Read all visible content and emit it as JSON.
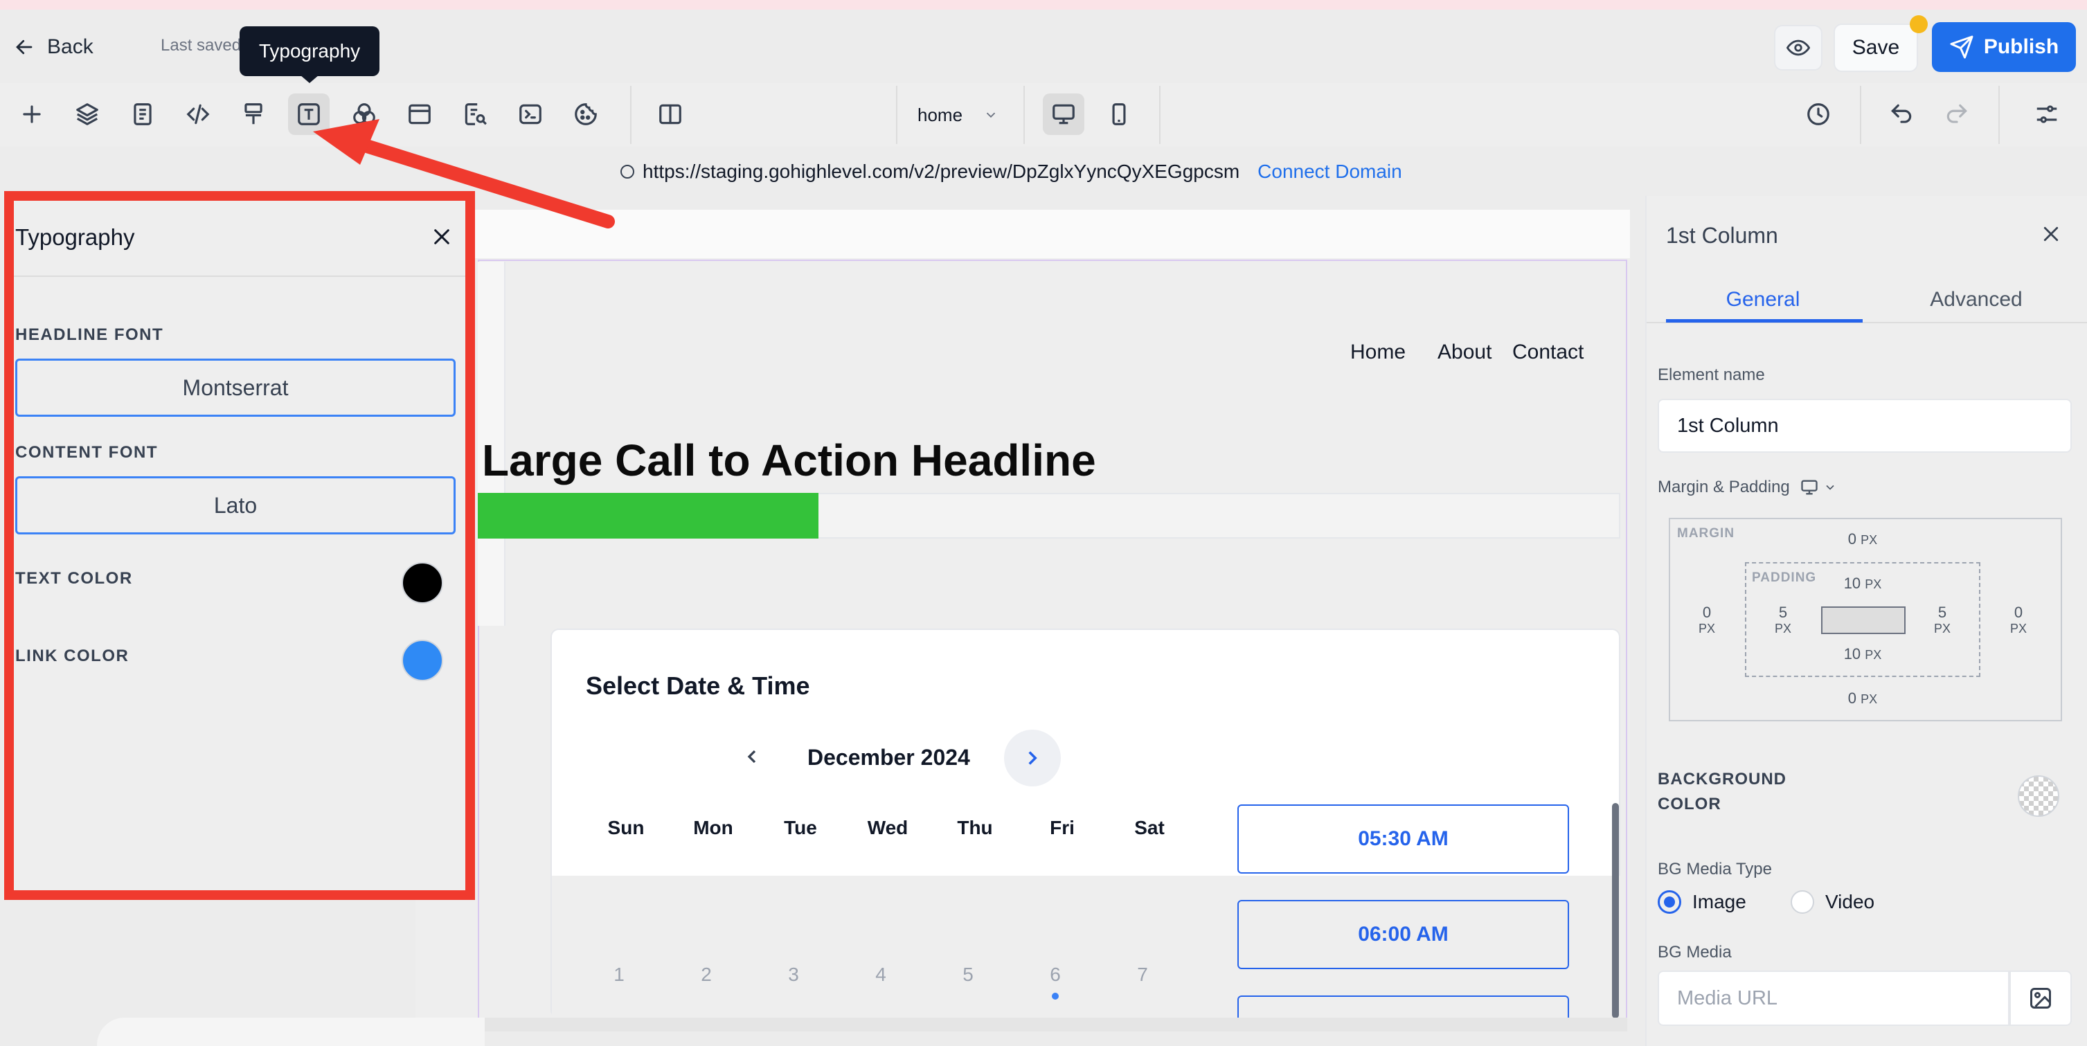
{
  "topbar": {
    "back_label": "Back",
    "last_saved": "Last saved",
    "tooltip": "Typography",
    "save_label": "Save",
    "publish_label": "Publish"
  },
  "toolbar": {
    "page_select": "home",
    "url": "https://staging.gohighlevel.com/v2/preview/DpZglxYyncQyXEGgpcsm",
    "connect_domain": "Connect Domain"
  },
  "typography_panel": {
    "title": "Typography",
    "headline_font_label": "HEADLINE FONT",
    "headline_font_value": "Montserrat",
    "content_font_label": "CONTENT FONT",
    "content_font_value": "Lato",
    "text_color_label": "TEXT COLOR",
    "link_color_label": "LINK COLOR",
    "text_color": "#000000",
    "link_color": "#2f8af5"
  },
  "canvas": {
    "nav": [
      "Home",
      "About",
      "Contact"
    ],
    "headline": "Large Call to Action Headline",
    "calendar_title": "Select Date & Time",
    "month": "December 2024",
    "weekdays": [
      "Sun",
      "Mon",
      "Tue",
      "Wed",
      "Thu",
      "Fri",
      "Sat"
    ],
    "dates": [
      "1",
      "2",
      "3",
      "4",
      "5",
      "6",
      "7"
    ],
    "slots": [
      "05:30 AM",
      "06:00 AM"
    ]
  },
  "right_panel": {
    "title": "1st Column",
    "tab_general": "General",
    "tab_advanced": "Advanced",
    "element_name_label": "Element name",
    "element_name_value": "1st Column",
    "margin_padding_label": "Margin & Padding",
    "margin_label": "MARGIN",
    "padding_label": "PADDING",
    "unit": "PX",
    "margin_top": "0",
    "margin_bottom": "0",
    "margin_left": "0",
    "margin_right": "0",
    "padding_top": "10",
    "padding_bottom": "10",
    "padding_left": "5",
    "padding_right": "5",
    "bg_color_label_1": "BACKGROUND",
    "bg_color_label_2": "COLOR",
    "bg_media_type_label": "BG Media Type",
    "opt_image": "Image",
    "opt_video": "Video",
    "bg_media_label": "BG Media",
    "media_url_placeholder": "Media URL"
  },
  "colors": {
    "accent": "#2563eb",
    "annotation": "#f03a2e",
    "green_bar": "#34c23a"
  }
}
